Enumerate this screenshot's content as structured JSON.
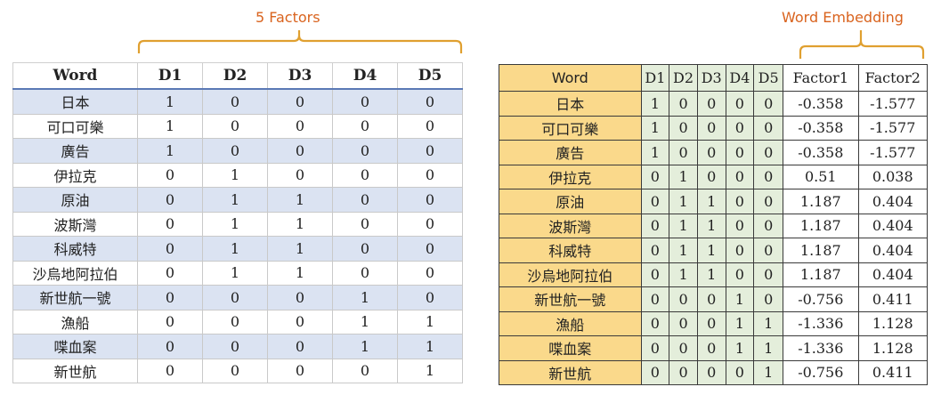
{
  "left": {
    "annotation": "5 Factors",
    "headers": [
      "Word",
      "D1",
      "D2",
      "D3",
      "D4",
      "D5"
    ],
    "rows": [
      [
        "日本",
        "1",
        "0",
        "0",
        "0",
        "0"
      ],
      [
        "可口可樂",
        "1",
        "0",
        "0",
        "0",
        "0"
      ],
      [
        "廣告",
        "1",
        "0",
        "0",
        "0",
        "0"
      ],
      [
        "伊拉克",
        "0",
        "1",
        "0",
        "0",
        "0"
      ],
      [
        "原油",
        "0",
        "1",
        "1",
        "0",
        "0"
      ],
      [
        "波斯灣",
        "0",
        "1",
        "1",
        "0",
        "0"
      ],
      [
        "科威特",
        "0",
        "1",
        "1",
        "0",
        "0"
      ],
      [
        "沙烏地阿拉伯",
        "0",
        "1",
        "1",
        "0",
        "0"
      ],
      [
        "新世航一號",
        "0",
        "0",
        "0",
        "1",
        "0"
      ],
      [
        "漁船",
        "0",
        "0",
        "0",
        "1",
        "1"
      ],
      [
        "喋血案",
        "0",
        "0",
        "0",
        "1",
        "1"
      ],
      [
        "新世航",
        "0",
        "0",
        "0",
        "0",
        "1"
      ]
    ]
  },
  "right": {
    "annotation": "Word Embedding",
    "headers": [
      "Word",
      "D1",
      "D2",
      "D3",
      "D4",
      "D5",
      "Factor1",
      "Factor2"
    ],
    "rows": [
      [
        "日本",
        "1",
        "0",
        "0",
        "0",
        "0",
        "-0.358",
        "-1.577"
      ],
      [
        "可口可樂",
        "1",
        "0",
        "0",
        "0",
        "0",
        "-0.358",
        "-1.577"
      ],
      [
        "廣告",
        "1",
        "0",
        "0",
        "0",
        "0",
        "-0.358",
        "-1.577"
      ],
      [
        "伊拉克",
        "0",
        "1",
        "0",
        "0",
        "0",
        "0.51",
        "0.038"
      ],
      [
        "原油",
        "0",
        "1",
        "1",
        "0",
        "0",
        "1.187",
        "0.404"
      ],
      [
        "波斯灣",
        "0",
        "1",
        "1",
        "0",
        "0",
        "1.187",
        "0.404"
      ],
      [
        "科威特",
        "0",
        "1",
        "1",
        "0",
        "0",
        "1.187",
        "0.404"
      ],
      [
        "沙烏地阿拉伯",
        "0",
        "1",
        "1",
        "0",
        "0",
        "1.187",
        "0.404"
      ],
      [
        "新世航一號",
        "0",
        "0",
        "0",
        "1",
        "0",
        "-0.756",
        "0.411"
      ],
      [
        "漁船",
        "0",
        "0",
        "0",
        "1",
        "1",
        "-1.336",
        "1.128"
      ],
      [
        "喋血案",
        "0",
        "0",
        "0",
        "1",
        "1",
        "-1.336",
        "1.128"
      ],
      [
        "新世航",
        "0",
        "0",
        "0",
        "0",
        "1",
        "-0.756",
        "0.411"
      ]
    ]
  },
  "colors": {
    "annotation_text": "#d9631e",
    "brace": "#e0a030",
    "left_header_rule": "#5a79b5",
    "left_alt_row": "#dbe3f2",
    "right_word_col": "#fad98b",
    "right_d_cols": "#e4eedb"
  }
}
